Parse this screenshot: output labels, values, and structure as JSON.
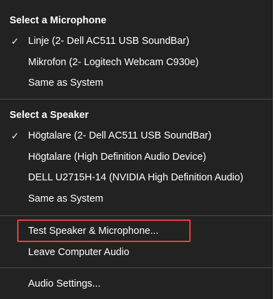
{
  "microphone": {
    "title": "Select a Microphone",
    "items": [
      {
        "label": "Linje (2- Dell AC511 USB SoundBar)",
        "checked": true
      },
      {
        "label": "Mikrofon (2- Logitech Webcam C930e)",
        "checked": false
      },
      {
        "label": "Same as System",
        "checked": false
      }
    ]
  },
  "speaker": {
    "title": "Select a Speaker",
    "items": [
      {
        "label": "Högtalare (2- Dell AC511 USB SoundBar)",
        "checked": true
      },
      {
        "label": "Högtalare (High Definition Audio Device)",
        "checked": false
      },
      {
        "label": "DELL U2715H-14 (NVIDIA High Definition Audio)",
        "checked": false
      },
      {
        "label": "Same as System",
        "checked": false
      }
    ]
  },
  "actions": {
    "test": "Test Speaker & Microphone...",
    "leave": "Leave Computer Audio"
  },
  "settings": {
    "label": "Audio Settings..."
  },
  "check_glyph": "✓",
  "colors": {
    "background": "#222222",
    "text": "#ffffff",
    "divider": "#4a4a4a",
    "highlight": "#e8413e"
  }
}
